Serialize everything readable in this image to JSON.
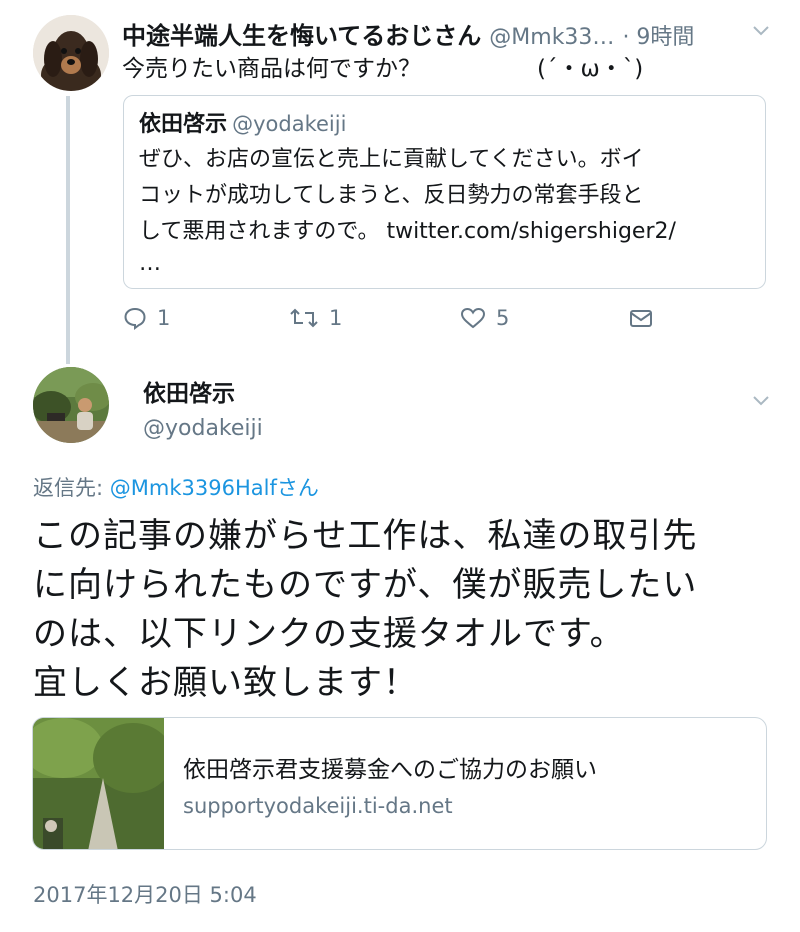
{
  "quoted_thread": {
    "author_name": "中途半端人生を悔いてるおじさん",
    "author_handle": "@Mmk33…",
    "time": "· 9時間",
    "text": "今売りたい商品は何ですか？",
    "emoticon": "(´・ω・`)",
    "quote": {
      "name": "依田啓示",
      "handle": "@yodakeiji",
      "lines": [
        "ぜひ、お店の宣伝と売上に貢献してください。ボイ",
        "コットが成功してしまうと、反日勢力の常套手段と",
        "して悪用されますので。 twitter.com/shigershiger2/",
        "…"
      ]
    },
    "actions": {
      "reply_count": "1",
      "retweet_count": "1",
      "like_count": "5"
    }
  },
  "main_tweet": {
    "author_name": "依田啓示",
    "author_handle": "@yodakeiji",
    "reply_label": "返信先:",
    "reply_to": "@Mmk3396Halfさん",
    "lines": [
      "この記事の嫌がらせ工作は、私達の取引先",
      "に向けられたものですが、僕が販売したい",
      "のは、以下リンクの支援タオルです。",
      "宜しくお願い致します！"
    ],
    "card": {
      "title": "依田啓示君支援募金へのご協力のお願い",
      "url": "supportyodakeiji.ti-da.net"
    },
    "timestamp": "2017年12月20日 5:04"
  },
  "icons": [
    "chevron-down-icon",
    "reply-icon",
    "retweet-icon",
    "like-icon",
    "message-icon"
  ],
  "colors": {
    "link": "#1b95e0",
    "secondary": "#657786",
    "border": "#ccd6dd",
    "text": "#14171a"
  }
}
